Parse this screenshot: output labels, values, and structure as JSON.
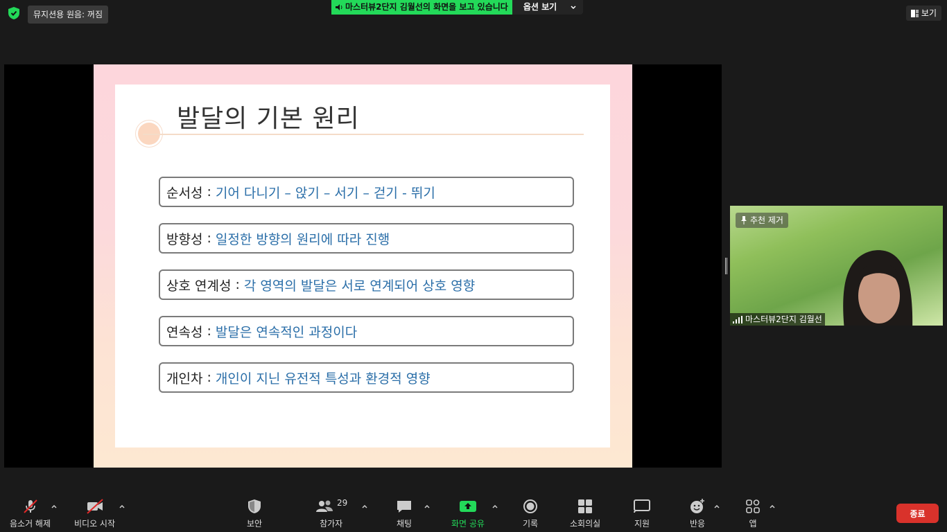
{
  "top": {
    "music_mode": "뮤지션용 원음: 꺼짐",
    "sharing_notice": "마스터뷰2단지 김월선의 화면을 보고 있습니다",
    "view_options": "옵션 보기",
    "view_label": "보기"
  },
  "slide": {
    "title": "발달의 기본 원리",
    "rows": [
      {
        "key": "순서성",
        "value": "기어 다니기 – 앉기 – 서기 – 걷기 - 뛰기"
      },
      {
        "key": "방향성",
        "value": "일정한 방향의 원리에 따라 진행"
      },
      {
        "key": "상호 연계성",
        "value": "각 영역의 발달은 서로 연계되어 상호 영향"
      },
      {
        "key": "연속성",
        "value": "발달은 연속적인 과정이다"
      },
      {
        "key": "개인차",
        "value": "개인이 지닌 유전적 특성과 환경적 영향"
      }
    ],
    "separator": ":"
  },
  "participant": {
    "pin_label": "추천 제거",
    "name": "마스터뷰2단지 김월선"
  },
  "toolbar": {
    "unmute": "음소거 해제",
    "start_video": "비디오 시작",
    "security": "보안",
    "participants": "참가자",
    "participant_count": "29",
    "chat": "채팅",
    "share_screen": "화면 공유",
    "record": "기록",
    "breakout": "소회의실",
    "support": "지원",
    "reactions": "반응",
    "apps": "앱",
    "end": "종료"
  },
  "colors": {
    "accent_green": "#23d959",
    "end_red": "#d9322b",
    "slide_text_blue": "#2a6ea8"
  }
}
